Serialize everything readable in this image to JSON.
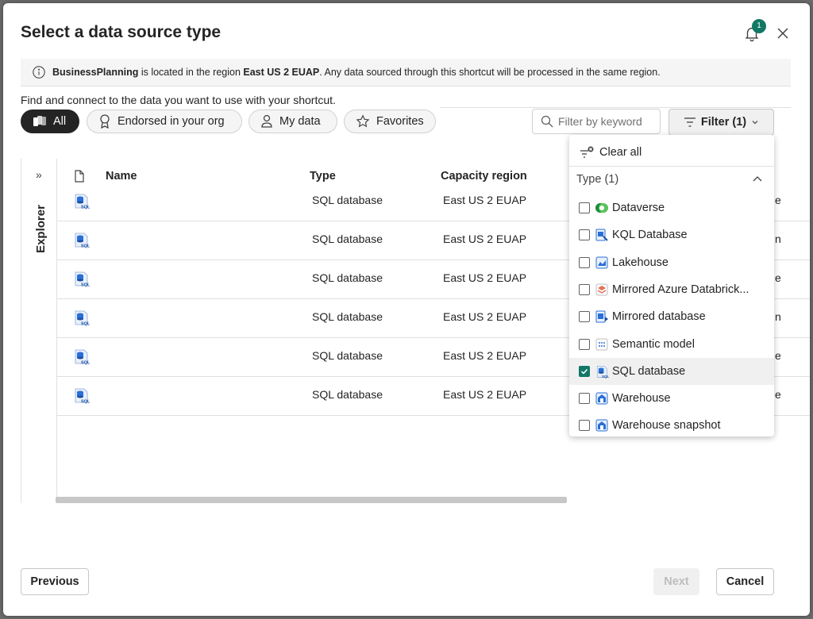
{
  "dialog": {
    "title": "Select a data source type",
    "notification_count": "1"
  },
  "info": {
    "workspace": "BusinessPlanning",
    "text1": " is located in the region ",
    "region": "East US 2 EUAP",
    "text2": ". Any data sourced through this shortcut will be processed in the same region."
  },
  "subtitle": "Find and connect to the data you want to use with your shortcut.",
  "pills": {
    "all": "All",
    "endorsed": "Endorsed in your org",
    "mydata": "My data",
    "favorites": "Favorites"
  },
  "search": {
    "placeholder": "Filter by keyword"
  },
  "filter": {
    "label": "Filter (1)"
  },
  "explorer": {
    "label": "Explorer"
  },
  "table": {
    "headers": {
      "name": "Name",
      "type": "Type",
      "region": "Capacity region"
    },
    "rows": [
      {
        "type": "SQL database",
        "region": "East US 2 EUAP",
        "trail": "e"
      },
      {
        "type": "SQL database",
        "region": "East US 2 EUAP",
        "trail": "n"
      },
      {
        "type": "SQL database",
        "region": "East US 2 EUAP",
        "trail": "e"
      },
      {
        "type": "SQL database",
        "region": "East US 2 EUAP",
        "trail": "n"
      },
      {
        "type": "SQL database",
        "region": "East US 2 EUAP",
        "trail": "e"
      },
      {
        "type": "SQL database",
        "region": "East US 2 EUAP",
        "trail": "e"
      }
    ]
  },
  "dropdown": {
    "clear_all": "Clear all",
    "type_header": "Type (1)",
    "items": [
      {
        "label": "Dataverse",
        "checked": false
      },
      {
        "label": "KQL Database",
        "checked": false
      },
      {
        "label": "Lakehouse",
        "checked": false
      },
      {
        "label": "Mirrored Azure Databrick...",
        "checked": false
      },
      {
        "label": "Mirrored database",
        "checked": false
      },
      {
        "label": "Semantic model",
        "checked": false
      },
      {
        "label": "SQL database",
        "checked": true
      },
      {
        "label": "Warehouse",
        "checked": false
      },
      {
        "label": "Warehouse snapshot",
        "checked": false
      }
    ]
  },
  "footer": {
    "previous": "Previous",
    "next": "Next",
    "cancel": "Cancel"
  },
  "colors": {
    "accent": "#117865",
    "pill_active": "#242424"
  }
}
